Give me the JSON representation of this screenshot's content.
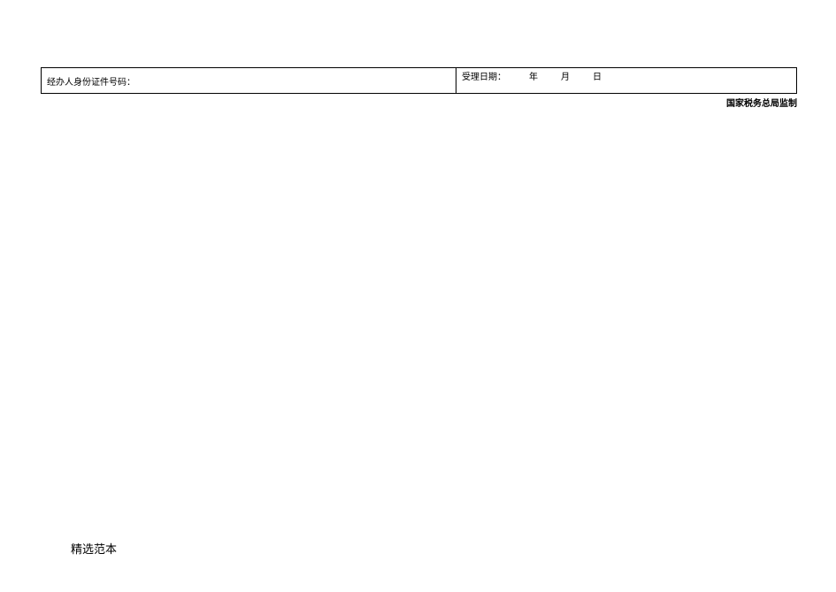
{
  "form": {
    "left_cell": {
      "id_number_label": "经办人身份证件号码："
    },
    "right_cell": {
      "accept_date_label": "受理日期：",
      "year_unit": "年",
      "month_unit": "月",
      "day_unit": "日"
    }
  },
  "footer": {
    "issuer": "国家税务总局监制"
  },
  "bottom": {
    "template_note": "精选范本"
  }
}
